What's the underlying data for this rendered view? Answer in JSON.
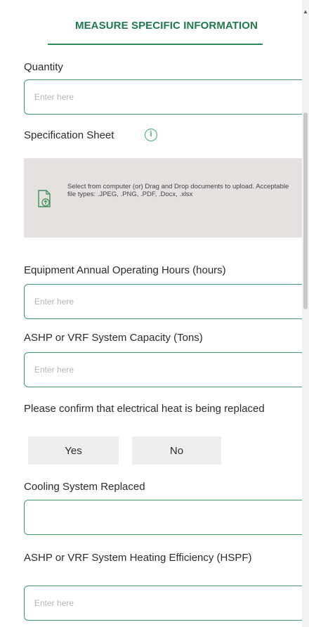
{
  "section": {
    "title": "MEASURE SPECIFIC INFORMATION"
  },
  "fields": {
    "quantity": {
      "label": "Quantity",
      "placeholder": "Enter here",
      "value": ""
    },
    "spec_sheet": {
      "label": "Specification Sheet",
      "info_icon": "info-circle-icon",
      "upload_icon": "file-upload-icon",
      "upload_text": "Select from computer (or) Drag and Drop documents to upload. Acceptable file types: .JPEG, .PNG, .PDF, .Docx, .xlsx"
    },
    "operating_hours": {
      "label": "Equipment Annual Operating Hours (hours)",
      "placeholder": "Enter here",
      "value": ""
    },
    "system_capacity": {
      "label": "ASHP or VRF System Capacity (Tons)",
      "placeholder": "Enter here",
      "value": ""
    },
    "electrical_heat": {
      "label": "Please confirm that electrical heat is being replaced",
      "yes_label": "Yes",
      "no_label": "No"
    },
    "cooling_system": {
      "label": "Cooling System Replaced",
      "placeholder": "",
      "value": ""
    },
    "heating_efficiency": {
      "label": "ASHP or VRF System Heating Efficiency (HSPF)",
      "placeholder": "Enter here",
      "value": ""
    }
  },
  "colors": {
    "accent": "#1f7a4a",
    "input_border": "#3d9b6a",
    "upload_bg": "#e4e1df",
    "button_bg": "#eeeeee"
  }
}
